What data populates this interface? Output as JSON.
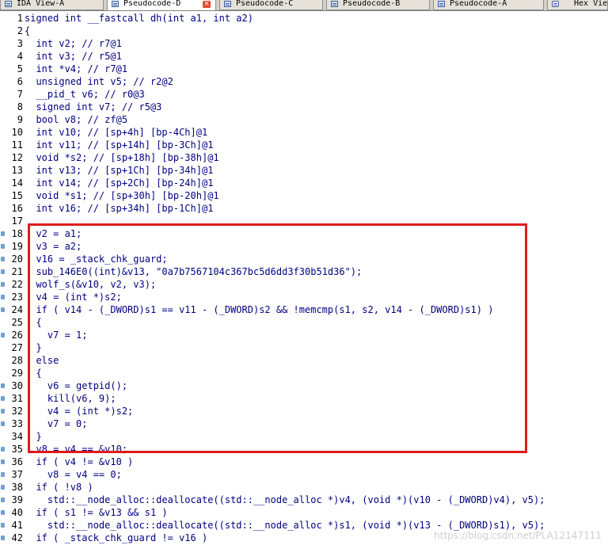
{
  "tabs": [
    {
      "label": "IDA View-A",
      "active": false,
      "closable": false
    },
    {
      "label": "Pseudocode-D",
      "active": true,
      "closable": true
    },
    {
      "label": "Pseudocode-C",
      "active": false,
      "closable": false
    },
    {
      "label": "Pseudocode-B",
      "active": false,
      "closable": false
    },
    {
      "label": "Pseudocode-A",
      "active": false,
      "closable": false
    },
    {
      "label": "Hex View",
      "active": false,
      "closable": false
    }
  ],
  "close_glyph": "×",
  "code": {
    "signature": "signed int __fastcall dh(int a1, int a2)",
    "lines": [
      {
        "n": "1",
        "dot": false,
        "text": ""
      },
      {
        "n": "2",
        "dot": false,
        "text": "{"
      },
      {
        "n": "3",
        "dot": false,
        "text": "  int v2; // r7@1"
      },
      {
        "n": "4",
        "dot": false,
        "text": "  int v3; // r5@1"
      },
      {
        "n": "5",
        "dot": false,
        "text": "  int *v4; // r7@1"
      },
      {
        "n": "6",
        "dot": false,
        "text": "  unsigned int v5; // r2@2"
      },
      {
        "n": "7",
        "dot": false,
        "text": "  __pid_t v6; // r0@3"
      },
      {
        "n": "8",
        "dot": false,
        "text": "  signed int v7; // r5@3"
      },
      {
        "n": "9",
        "dot": false,
        "text": "  bool v8; // zf@5"
      },
      {
        "n": "10",
        "dot": false,
        "text": "  int v10; // [sp+4h] [bp-4Ch]@1"
      },
      {
        "n": "11",
        "dot": false,
        "text": "  int v11; // [sp+14h] [bp-3Ch]@1"
      },
      {
        "n": "12",
        "dot": false,
        "text": "  void *s2; // [sp+18h] [bp-38h]@1"
      },
      {
        "n": "13",
        "dot": false,
        "text": "  int v13; // [sp+1Ch] [bp-34h]@1"
      },
      {
        "n": "14",
        "dot": false,
        "text": "  int v14; // [sp+2Ch] [bp-24h]@1"
      },
      {
        "n": "15",
        "dot": false,
        "text": "  void *s1; // [sp+30h] [bp-20h]@1"
      },
      {
        "n": "16",
        "dot": false,
        "text": "  int v16; // [sp+34h] [bp-1Ch]@1"
      },
      {
        "n": "17",
        "dot": false,
        "text": ""
      },
      {
        "n": "18",
        "dot": true,
        "text": "  v2 = a1;"
      },
      {
        "n": "19",
        "dot": true,
        "text": "  v3 = a2;"
      },
      {
        "n": "20",
        "dot": true,
        "text": "  v16 = _stack_chk_guard;"
      },
      {
        "n": "21",
        "dot": true,
        "text": "  sub_146E0((int)&v13, \"0a7b7567104c367bc5d6dd3f30b51d36\");"
      },
      {
        "n": "22",
        "dot": true,
        "text": "  wolf_s(&v10, v2, v3);"
      },
      {
        "n": "23",
        "dot": true,
        "text": "  v4 = (int *)s2;"
      },
      {
        "n": "24",
        "dot": true,
        "text": "  if ( v14 - (_DWORD)s1 == v11 - (_DWORD)s2 && !memcmp(s1, s2, v14 - (_DWORD)s1) )"
      },
      {
        "n": "25",
        "dot": false,
        "text": "  {"
      },
      {
        "n": "26",
        "dot": true,
        "text": "    v7 = 1;"
      },
      {
        "n": "27",
        "dot": false,
        "text": "  }"
      },
      {
        "n": "28",
        "dot": false,
        "text": "  else"
      },
      {
        "n": "29",
        "dot": false,
        "text": "  {"
      },
      {
        "n": "30",
        "dot": true,
        "text": "    v6 = getpid();"
      },
      {
        "n": "31",
        "dot": true,
        "text": "    kill(v6, 9);"
      },
      {
        "n": "32",
        "dot": true,
        "text": "    v4 = (int *)s2;"
      },
      {
        "n": "33",
        "dot": true,
        "text": "    v7 = 0;"
      },
      {
        "n": "34",
        "dot": false,
        "text": "  }"
      },
      {
        "n": "35",
        "dot": true,
        "text": "  v8 = v4 == &v10;"
      },
      {
        "n": "36",
        "dot": true,
        "text": "  if ( v4 != &v10 )"
      },
      {
        "n": "37",
        "dot": true,
        "text": "    v8 = v4 == 0;"
      },
      {
        "n": "38",
        "dot": true,
        "text": "  if ( !v8 )"
      },
      {
        "n": "39",
        "dot": true,
        "text": "    std::__node_alloc::deallocate((std::__node_alloc *)v4, (void *)(v10 - (_DWORD)v4), v5);"
      },
      {
        "n": "40",
        "dot": true,
        "text": "  if ( s1 != &v13 && s1 )"
      },
      {
        "n": "41",
        "dot": true,
        "text": "    std::__node_alloc::deallocate((std::__node_alloc *)s1, (void *)(v13 - (_DWORD)s1), v5);"
      },
      {
        "n": "42",
        "dot": true,
        "text": "  if ( _stack_chk_guard != v16 )"
      }
    ]
  },
  "watermark": "https://blog.csdn.net/PLA12147111"
}
